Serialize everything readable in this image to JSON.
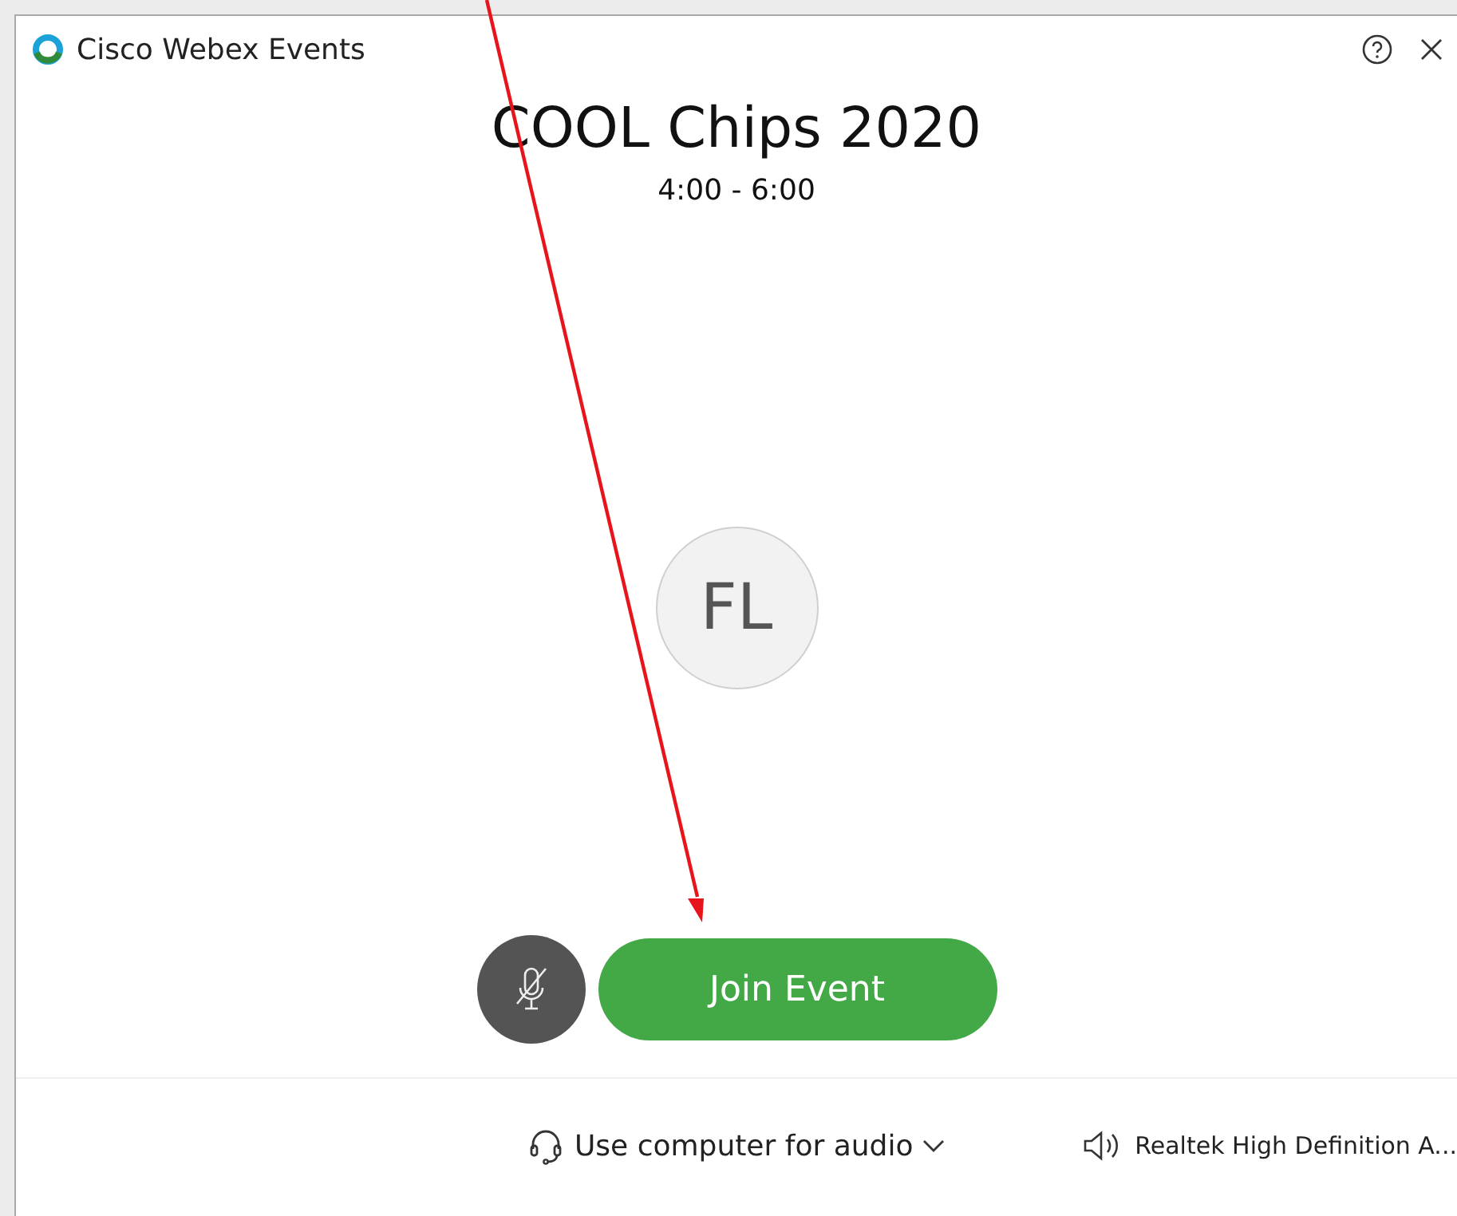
{
  "window": {
    "title": "Cisco Webex Events"
  },
  "event": {
    "title": "COOL Chips 2020",
    "time": "4:00 - 6:00"
  },
  "avatar": {
    "initials": "FL"
  },
  "mic": {
    "muted": true
  },
  "join_button": {
    "label": "Join Event"
  },
  "audio": {
    "connection": "Use computer for audio",
    "speaker": "Realtek High Definition A..."
  }
}
